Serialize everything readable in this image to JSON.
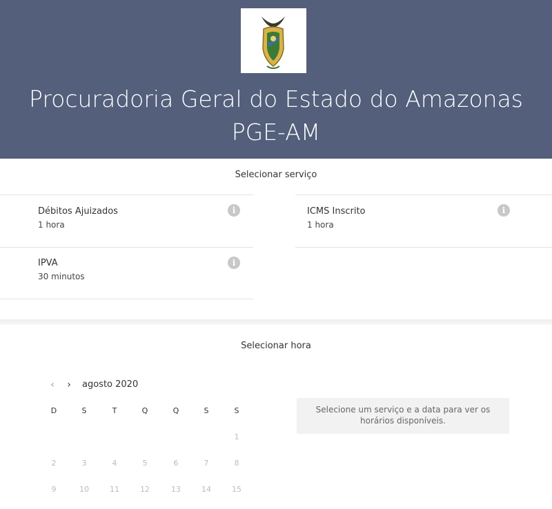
{
  "header": {
    "title": "Procuradoria Geral do Estado do Amazonas PGE-AM",
    "logo_icon": "coat-of-arms-icon",
    "background": "#535f7b"
  },
  "services": {
    "section_title": "Selecionar serviço",
    "items": [
      {
        "name": "Débitos Ajuizados",
        "duration": "1 hora",
        "icon": "info-icon"
      },
      {
        "name": "ICMS Inscrito",
        "duration": "1 hora",
        "icon": "info-icon"
      },
      {
        "name": "IPVA",
        "duration": "30 minutos",
        "icon": "info-icon"
      }
    ]
  },
  "time": {
    "section_title": "Selecionar hora",
    "calendar": {
      "prev_icon": "chevron-left-icon",
      "next_icon": "chevron-right-icon",
      "month_label": "agosto 2020",
      "weekdays": [
        "D",
        "S",
        "T",
        "Q",
        "Q",
        "S",
        "S"
      ],
      "weeks": [
        [
          "",
          "",
          "",
          "",
          "",
          "",
          "1"
        ],
        [
          "2",
          "3",
          "4",
          "5",
          "6",
          "7",
          "8"
        ],
        [
          "9",
          "10",
          "11",
          "12",
          "13",
          "14",
          "15"
        ]
      ]
    },
    "slots_message": "Selecione um serviço e a data para ver os horários disponíveis."
  }
}
